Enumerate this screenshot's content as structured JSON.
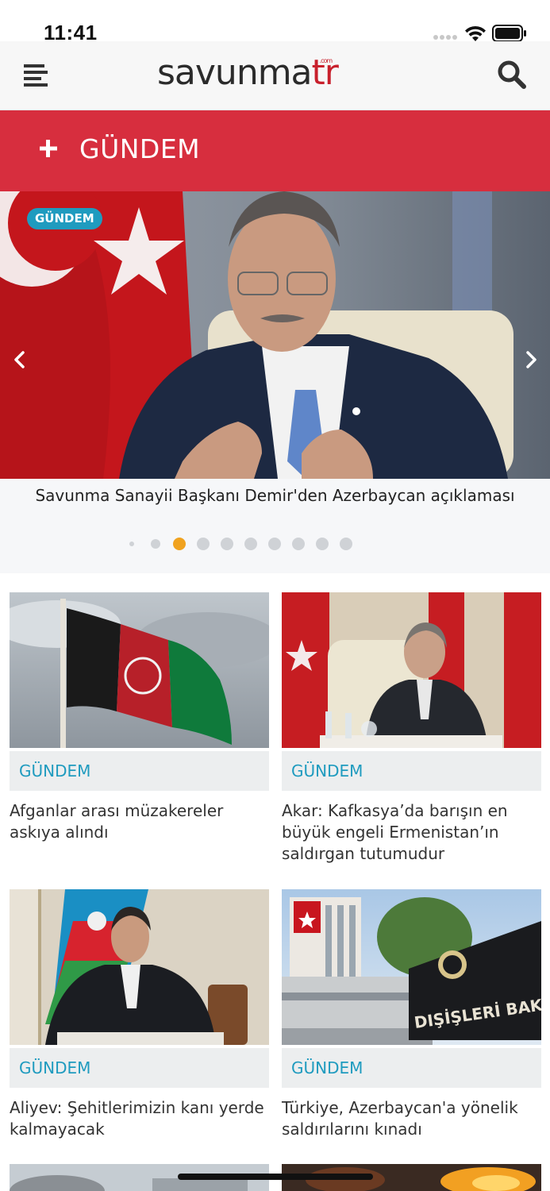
{
  "status": {
    "time": "11:41"
  },
  "nav": {
    "logo_main": "savunma",
    "logo_tr": "tr",
    "logo_com": ".com"
  },
  "category": {
    "title": "GÜNDEM"
  },
  "slider": {
    "badge": "GÜNDEM",
    "caption": "Savunma Sanayii Başkanı Demir'den Azerbaycan açıklaması",
    "dot_count": 10,
    "active_index": 2,
    "active_color": "#f0a21f"
  },
  "cards": [
    {
      "category": "GÜNDEM",
      "title": "Afganlar arası müzakereler askıya alındı"
    },
    {
      "category": "GÜNDEM",
      "title": "Akar: Kafkasya’da barışın en büyük engeli Ermenistan’ın saldırgan tutumudur"
    },
    {
      "category": "GÜNDEM",
      "title": "Aliyev: Şehitlerimizin kanı yerde kalmayacak"
    },
    {
      "category": "GÜNDEM",
      "title": "Türkiye, Azerbaycan'a yönelik saldırılarını kınadı"
    }
  ],
  "colors": {
    "brand_red": "#d72e3e",
    "accent_blue": "#1f9bbf",
    "logo_red": "#c8202c"
  }
}
